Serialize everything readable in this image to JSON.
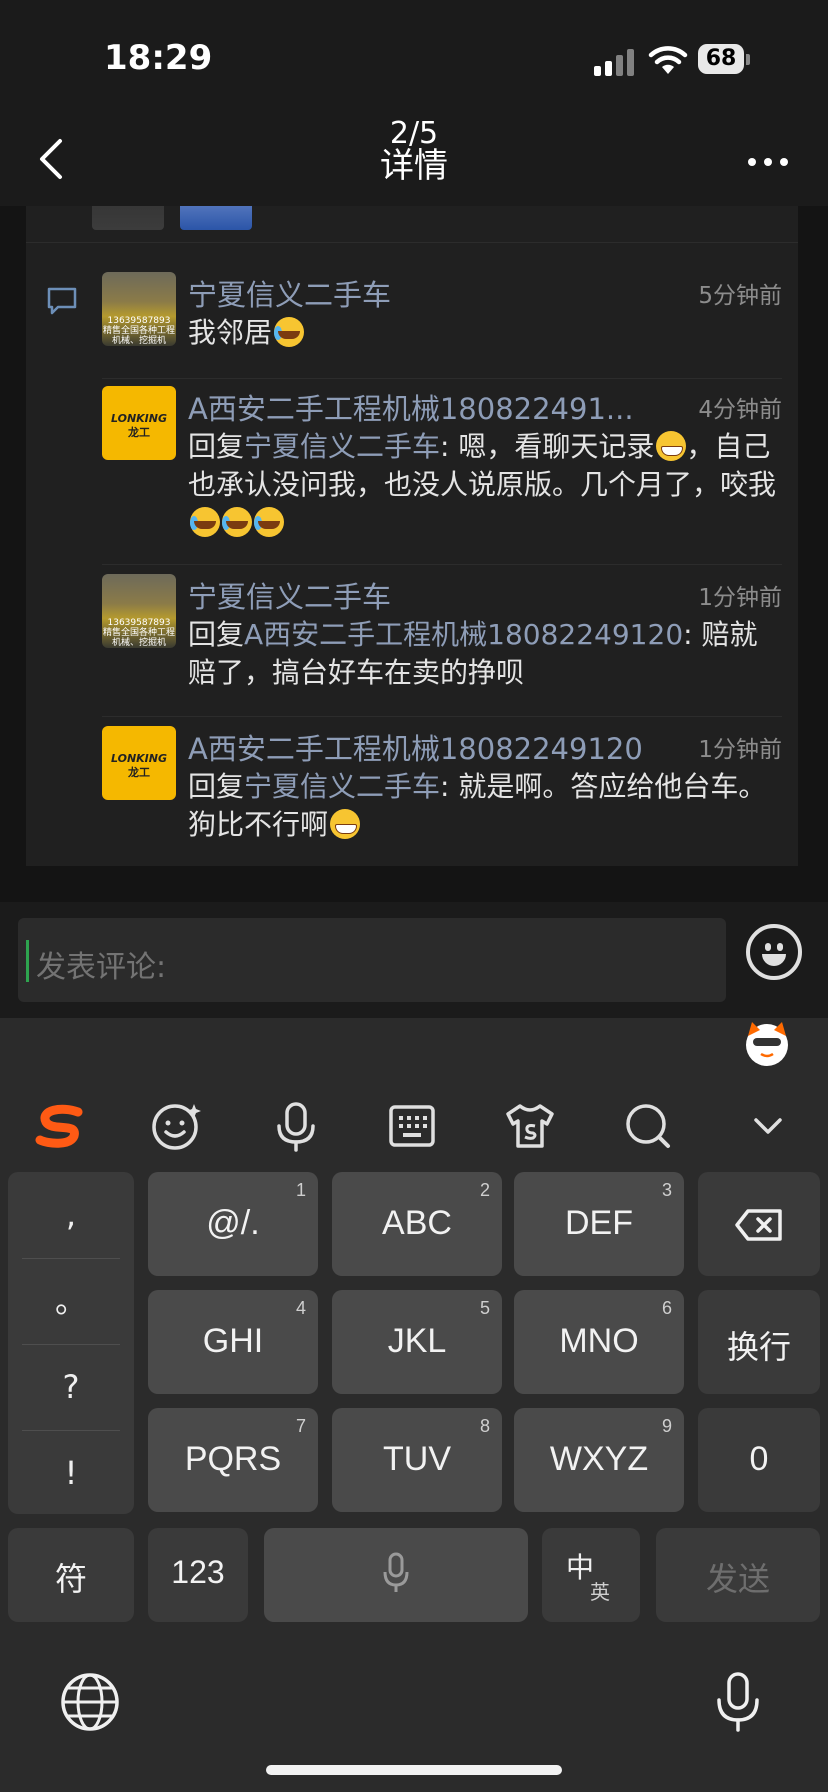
{
  "status_bar": {
    "time": "18:29",
    "battery": "68"
  },
  "nav": {
    "counter": "2/5",
    "title": "详情"
  },
  "comments": [
    {
      "name": "宁夏信义二手车",
      "time": "5分钟前",
      "text": "我邻居",
      "avatar_text": "13639587893 精售全国各种工程机械、挖掘机"
    },
    {
      "name": "A西安二手工程机械180822491...",
      "time": "4分钟前",
      "reply_prefix": "回复",
      "reply_to": "宁夏信义二手车",
      "text_a": ": 嗯，看聊天记录",
      "text_b": "，自己也承认没问我，也没人说原版。几个月了，咬我",
      "avatar_brand": "LONKING",
      "avatar_cn": "龙工"
    },
    {
      "name": "宁夏信义二手车",
      "time": "1分钟前",
      "reply_prefix": "回复",
      "reply_to": "A西安二手工程机械18082249120",
      "text": ": 赔就赔了，搞台好车在卖的挣呗",
      "avatar_text": "13639587893 精售全国各种工程机械、挖掘机"
    },
    {
      "name": "A西安二手工程机械18082249120",
      "time": "1分钟前",
      "reply_prefix": "回复",
      "reply_to": "宁夏信义二手车",
      "text": ": 就是啊。答应给他台车。狗比不行啊",
      "avatar_brand": "LONKING",
      "avatar_cn": "龙工"
    }
  ],
  "input": {
    "placeholder": "发表评论:"
  },
  "keyboard": {
    "punct": [
      ",",
      "。",
      "?",
      "!"
    ],
    "keys": [
      {
        "label": "@/.",
        "num": "1"
      },
      {
        "label": "ABC",
        "num": "2"
      },
      {
        "label": "DEF",
        "num": "3"
      },
      {
        "label": "GHI",
        "num": "4"
      },
      {
        "label": "JKL",
        "num": "5"
      },
      {
        "label": "MNO",
        "num": "6"
      },
      {
        "label": "PQRS",
        "num": "7"
      },
      {
        "label": "TUV",
        "num": "8"
      },
      {
        "label": "WXYZ",
        "num": "9"
      }
    ],
    "newline": "换行",
    "zero": "0",
    "symbols": "符",
    "numbers": "123",
    "lang_cn": "中",
    "lang_en": "英",
    "send": "发送"
  }
}
